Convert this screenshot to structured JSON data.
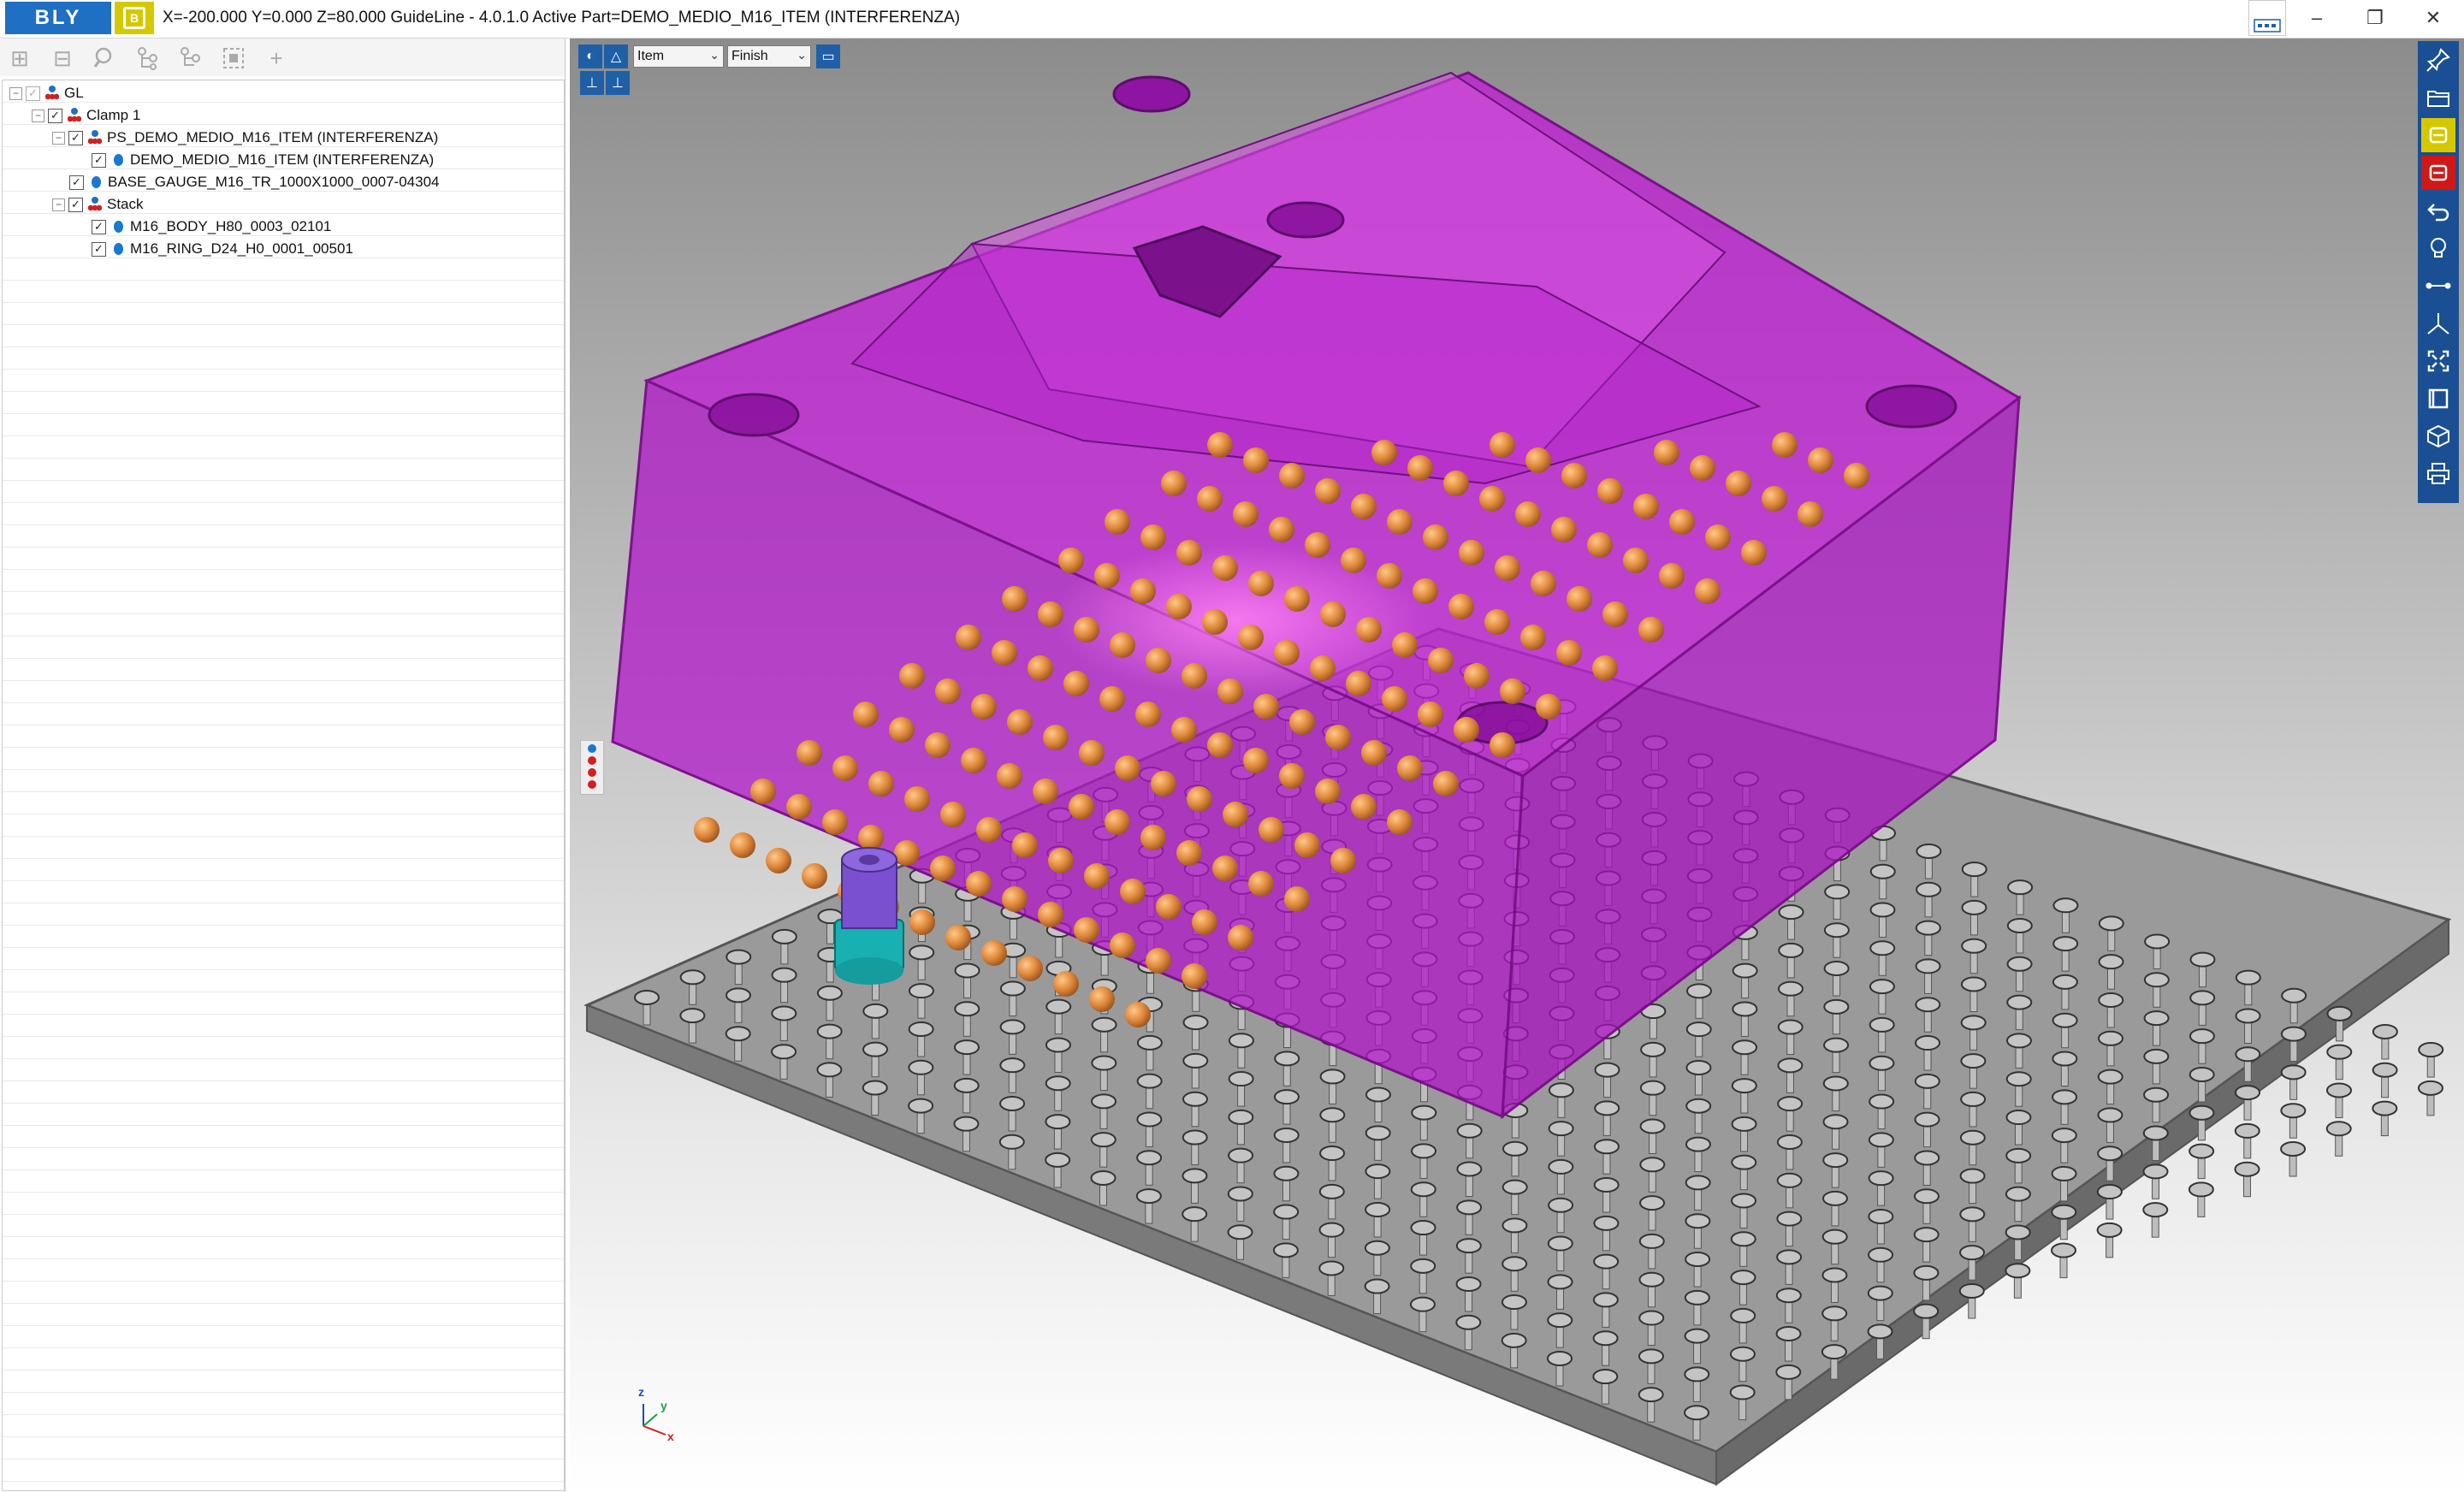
{
  "app": {
    "logo": "BLY",
    "logo_b": "B",
    "title": "X=-200.000 Y=0.000 Z=80.000   GuideLine - 4.0.1.0 Active Part=DEMO_MEDIO_M16_ITEM (INTERFERENZA)"
  },
  "window_controls": [
    "–",
    "❐",
    "✕"
  ],
  "tree_toolbar": [
    "expand-all",
    "collapse-all",
    "find",
    "tree-branch-1",
    "tree-branch-2",
    "fit",
    "add"
  ],
  "tree": [
    {
      "label": "GL",
      "level": 0,
      "kind": "group",
      "checked": true
    },
    {
      "label": "Clamp 1",
      "level": 1,
      "kind": "group",
      "checked": true
    },
    {
      "label": "PS_DEMO_MEDIO_M16_ITEM (INTERFERENZA)",
      "level": 2,
      "kind": "group",
      "checked": true
    },
    {
      "label": "DEMO_MEDIO_M16_ITEM (INTERFERENZA)",
      "level": 3,
      "kind": "part",
      "checked": true
    },
    {
      "label": "BASE_GAUGE_M16_TR_1000X1000_0007-04304",
      "level": 2,
      "kind": "part",
      "checked": true
    },
    {
      "label": "Stack",
      "level": 2,
      "kind": "group",
      "checked": true
    },
    {
      "label": "M16_BODY_H80_0003_02101",
      "level": 3,
      "kind": "part",
      "checked": true
    },
    {
      "label": "M16_RING_D24_H0_0001_00501",
      "level": 3,
      "kind": "part",
      "checked": true
    }
  ],
  "viewport": {
    "combo1": "Item",
    "combo2": "Finish",
    "axes": {
      "x": "x",
      "y": "y",
      "z": "z"
    },
    "colors": {
      "part": "#c817d9",
      "base": "#8a8a8a",
      "ball": "#e0893c",
      "body": "#7a4fd0",
      "ring": "#18b0b0"
    }
  },
  "right_toolbar": [
    "pin-icon",
    "open-folder-icon",
    "yellow-b-icon",
    "red-b-icon",
    "undo-icon",
    "lightbulb-icon",
    "measure-icon",
    "axis-icon",
    "fit-view-icon",
    "window-icon",
    "cube-icon",
    "print-icon"
  ]
}
